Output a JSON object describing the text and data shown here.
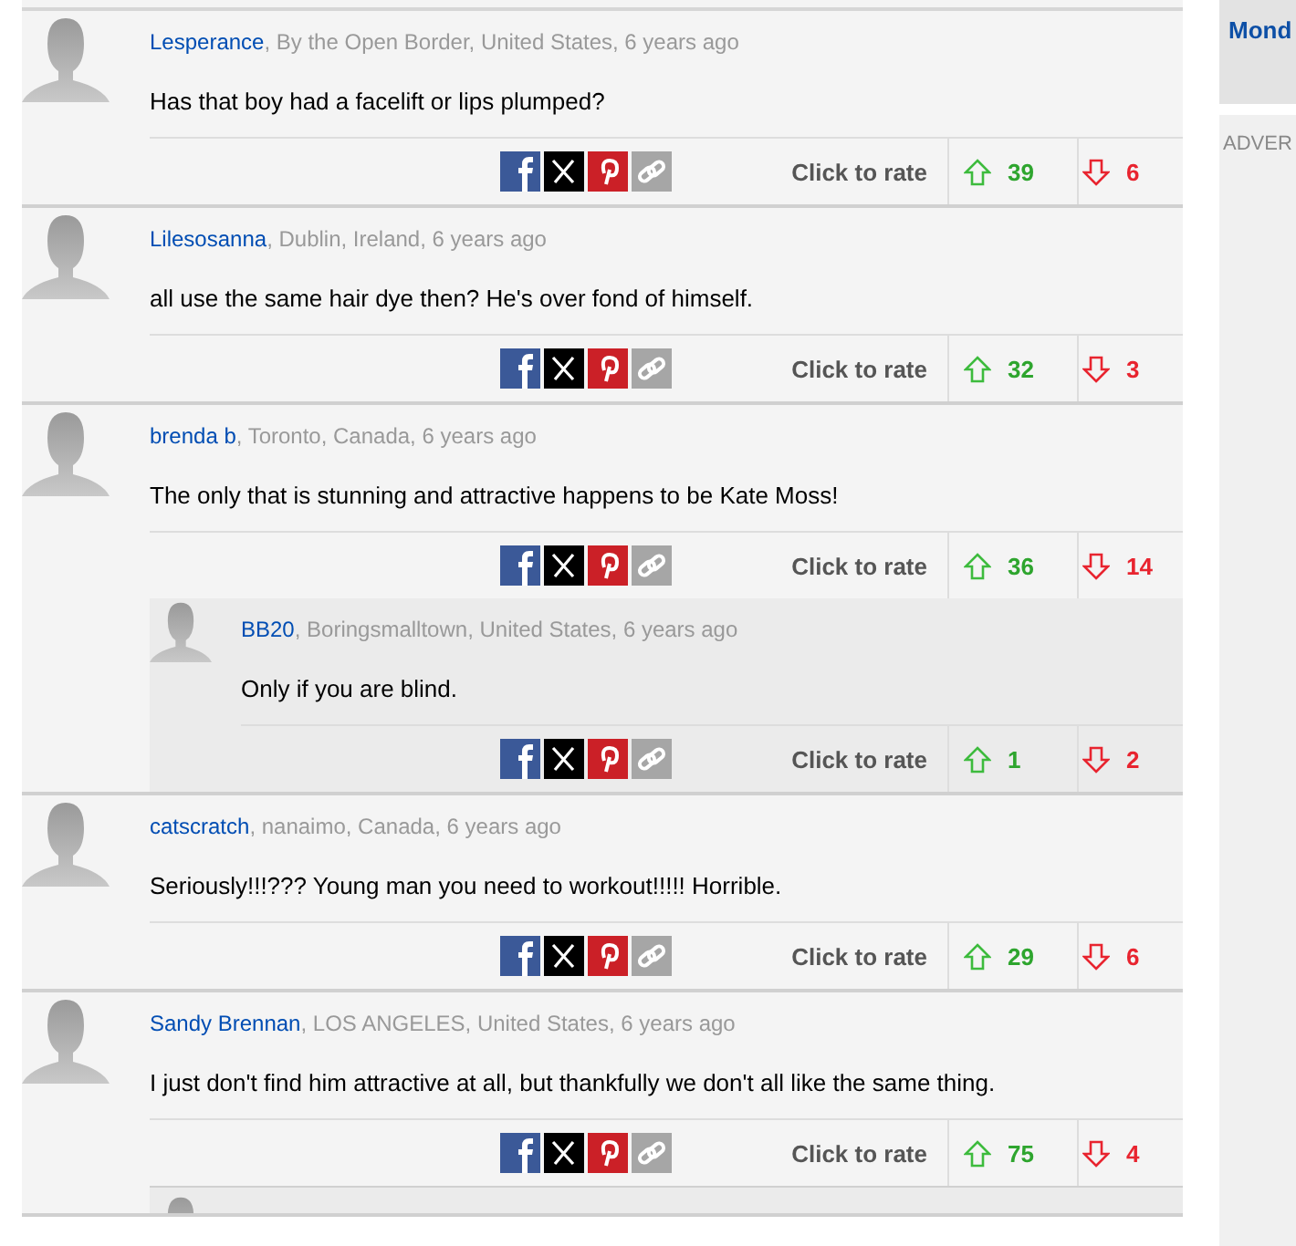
{
  "comments": [
    {
      "author": "Lesperance",
      "details": ", By the Open Border, United States, 6 years ago",
      "text": "Has that boy had a facelift or lips plumped?",
      "rate_label": "Click to rate",
      "up": "39",
      "down": "6"
    },
    {
      "author": "Lilesosanna",
      "details": ", Dublin, Ireland, 6 years ago",
      "text": "all use the same hair dye then? He's over fond of himself.",
      "rate_label": "Click to rate",
      "up": "32",
      "down": "3"
    },
    {
      "author": "brenda b",
      "details": ", Toronto, Canada, 6 years ago",
      "text": "The only that is stunning and attractive happens to be Kate Moss!",
      "rate_label": "Click to rate",
      "up": "36",
      "down": "14",
      "replies": [
        {
          "author": "BB20",
          "details": ", Boringsmalltown, United States, 6 years ago",
          "text": "Only if you are blind.",
          "rate_label": "Click to rate",
          "up": "1",
          "down": "2"
        }
      ]
    },
    {
      "author": "catscratch",
      "details": ", nanaimo, Canada, 6 years ago",
      "text": "Seriously!!!??? Young man you need to workout!!!!! Horrible.",
      "rate_label": "Click to rate",
      "up": "29",
      "down": "6"
    },
    {
      "author": "Sandy Brennan",
      "details": ", LOS ANGELES, United States, 6 years ago",
      "text": "I just don't find him attractive at all, but thankfully we don't all like the same thing.",
      "rate_label": "Click to rate",
      "up": "75",
      "down": "4",
      "reply_cut": true
    }
  ],
  "sidebar": {
    "headline": "Mond",
    "ad_label": "ADVER"
  }
}
